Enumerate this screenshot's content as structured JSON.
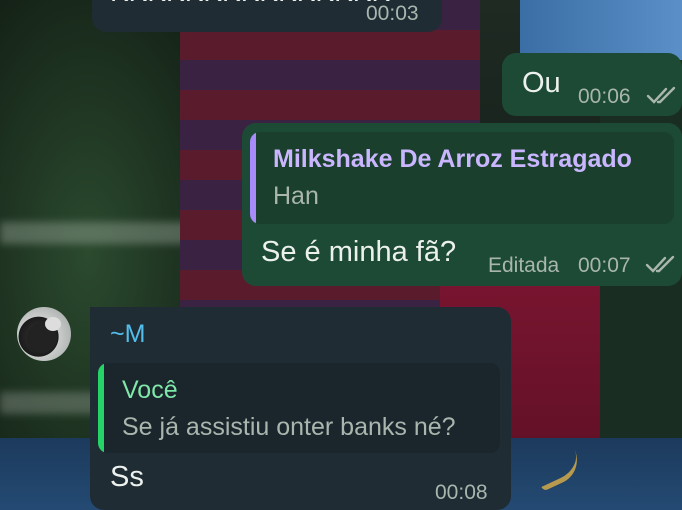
{
  "messages": [
    {
      "id": "m1",
      "direction": "incoming",
      "text": "KKKKKKKKKKKKKKK",
      "time": "00:03"
    },
    {
      "id": "m2",
      "direction": "outgoing",
      "text": "Ou",
      "time": "00:06",
      "status": "read"
    },
    {
      "id": "m3",
      "direction": "outgoing",
      "quote": {
        "author": "Milkshake De Arroz Estragado",
        "text": "Han"
      },
      "text": "Se é minha fã?",
      "edited_label": "Editada",
      "time": "00:07",
      "status": "read"
    },
    {
      "id": "m4",
      "direction": "incoming",
      "sender": "~M",
      "quote": {
        "author": "Você",
        "text": "Se já assistiu onter banks né?"
      },
      "text": "Ss",
      "time": "00:08"
    }
  ],
  "colors": {
    "incoming_bubble": "#1f2c34",
    "outgoing_bubble": "#1d4a35",
    "quote_bar_purple": "#a78bfa",
    "quote_bar_green": "#25d366",
    "sender_name": "#53bdeb",
    "quote_author_purple": "#c9b6ff",
    "quote_author_green": "#7fe7a8",
    "read_ticks": "#a9b6ae"
  },
  "icons": {
    "read_receipt": "double-check-icon"
  }
}
